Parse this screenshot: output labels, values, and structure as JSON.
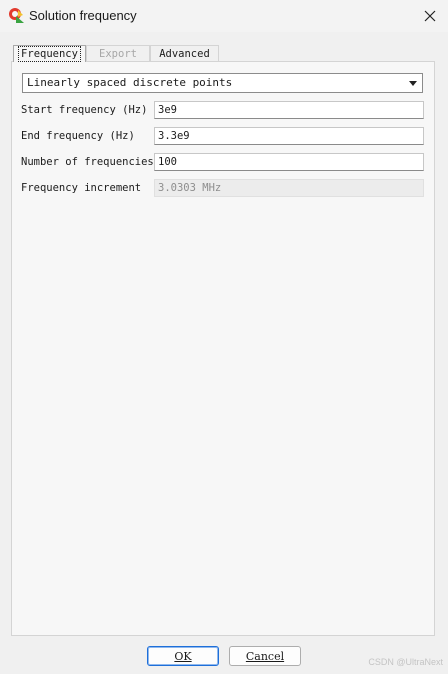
{
  "window": {
    "title": "Solution frequency"
  },
  "tabs": [
    {
      "label": "Frequency",
      "state": "active"
    },
    {
      "label": "Export",
      "state": "disabled"
    },
    {
      "label": "Advanced",
      "state": "normal"
    }
  ],
  "sweep_type": {
    "selected": "Linearly spaced discrete points"
  },
  "fields": [
    {
      "label": "Start frequency (Hz)",
      "value": "3e9"
    },
    {
      "label": "End frequency (Hz)",
      "value": "3.3e9"
    },
    {
      "label": "Number of frequencies",
      "value": "100"
    },
    {
      "label": "Frequency increment",
      "value": "3.0303 MHz",
      "readonly": true
    }
  ],
  "buttons": {
    "ok": "OK",
    "cancel": "Cancel"
  },
  "watermark": "CSDN @UltraNext"
}
